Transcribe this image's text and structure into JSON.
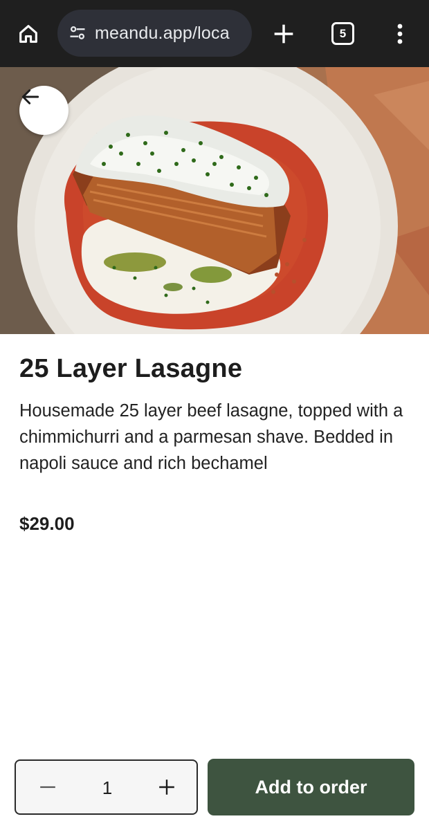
{
  "browser": {
    "url": "meandu.app/loca",
    "tab_count": "5"
  },
  "item": {
    "name": "25 Layer Lasagne",
    "description": "Housemade 25 layer beef lasagne, topped with a chimmichurri and a parmesan shave. Bedded in napoli sauce and rich bechamel",
    "price": "$29.00",
    "image": "photo of layered lasagne on napoli sauce and bechamel with parmesan and chives"
  },
  "order": {
    "quantity": "1",
    "add_label": "Add to order"
  },
  "icons": {
    "home": "home-icon",
    "site_settings": "tune-icon",
    "new_tab": "plus-icon",
    "menu": "more-vertical-icon",
    "back": "arrow-left-icon",
    "decrement": "minus-icon",
    "increment": "plus-icon"
  },
  "colors": {
    "browser_bar": "#1f1f1f",
    "url_pill": "#2e3038",
    "primary_button": "#3e5440",
    "text": "#1d1d1d"
  }
}
